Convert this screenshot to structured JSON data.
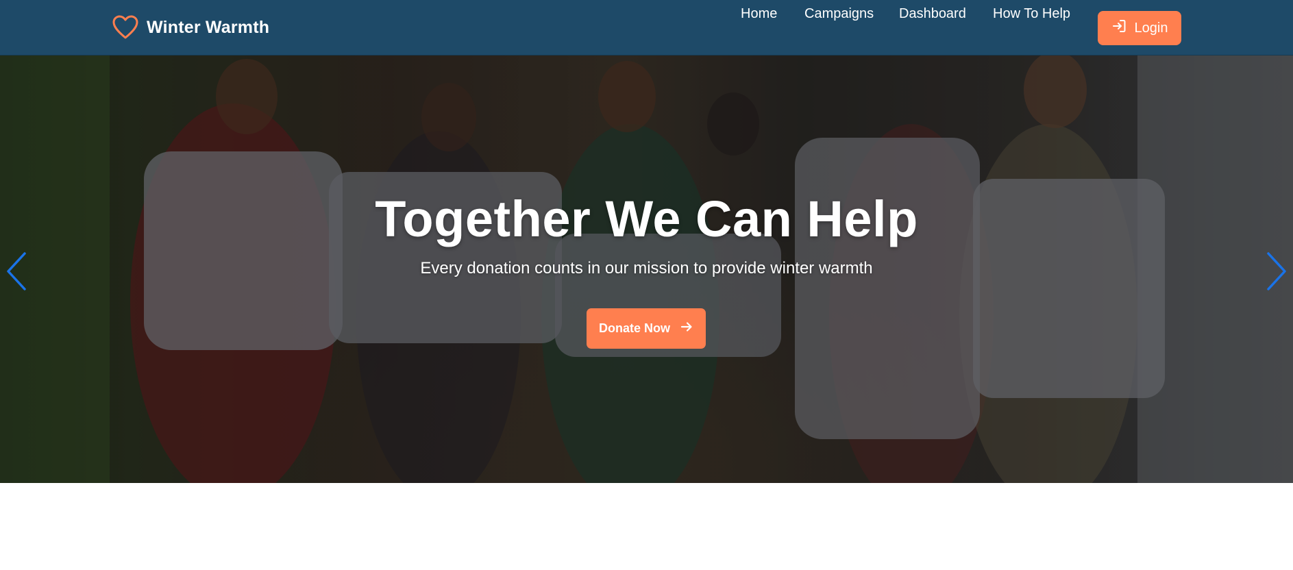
{
  "brand": {
    "name": "Winter Warmth",
    "icon": "heart-icon",
    "icon_color": "#ff7f4f"
  },
  "nav": {
    "links": [
      "Home",
      "Campaigns",
      "Dashboard",
      "How To Help"
    ],
    "login_label": "Login",
    "login_icon": "login-icon"
  },
  "hero": {
    "title": "Together We Can Help",
    "subtitle": "Every donation counts in our mission to provide winter warmth",
    "cta_label": "Donate Now",
    "cta_icon": "arrow-right-icon",
    "prev_icon": "chevron-left-icon",
    "next_icon": "chevron-right-icon"
  },
  "colors": {
    "navbar": "#1e4a68",
    "accent": "#ff7f4f",
    "carousel_arrow": "#1a73e8",
    "text_light": "#ffffff"
  }
}
